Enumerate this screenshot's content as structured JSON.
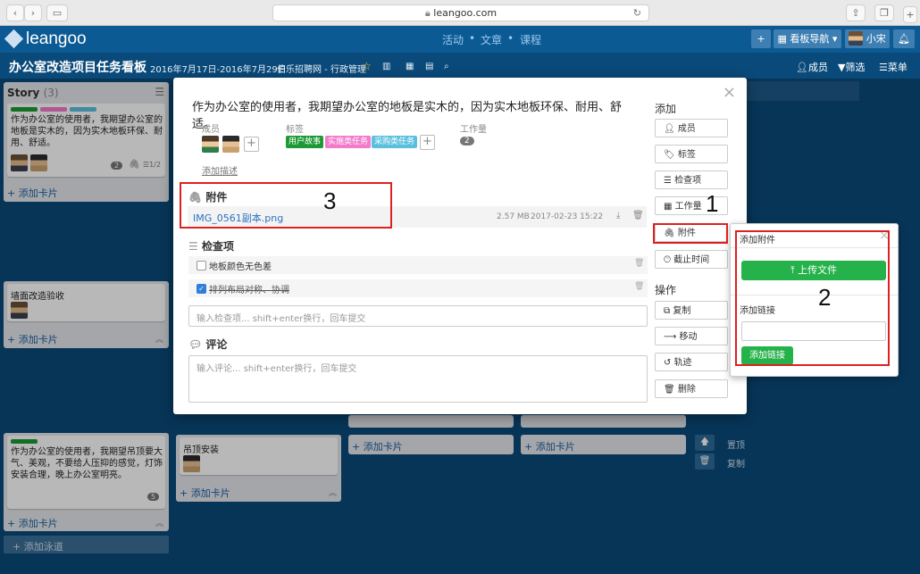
{
  "browser": {
    "url": "leangoo.com",
    "back": "‹",
    "forward": "›",
    "share": "⇪",
    "tabs": "❐",
    "newtab": "+"
  },
  "app": {
    "logo": "leangoo",
    "nav": [
      "活动",
      "文章",
      "课程"
    ],
    "nav_sep": "•",
    "plus": "+",
    "board_nav": "看板导航",
    "user": "小宋"
  },
  "board": {
    "title": "办公室改造项目任务看板",
    "dates": "2016年7月17日-2016年7月29日",
    "org": "伯乐招聘网 - 行政管理",
    "members": "成员",
    "filter": "筛选",
    "menu": "菜单"
  },
  "lists": {
    "story": {
      "title": "Story",
      "count": "(3)",
      "card1_text": "作为办公室的使用者，我期望办公室的地板是实木的，因为实木地板环保、耐用、舒适。",
      "card1_badge": "2",
      "card1_checks": "1/2",
      "add": "+ 添加卡片"
    },
    "list2": {
      "card_text": "墙面改造验收",
      "add": "+ 添加卡片"
    },
    "list3": {
      "card_text": "作为办公室的使用者，我期望吊顶要大气、美观，不要给人压抑的感觉，灯饰安装合理，晚上办公室明亮。",
      "card_badge": "5",
      "add": "+ 添加卡片"
    },
    "list4": {
      "card_text": "吊顶安装",
      "add": "+ 添加卡片"
    },
    "list5_add": "+ 添加卡片",
    "list6_add": "+ 添加卡片",
    "add_lane": "+ 添加泳道",
    "top": "置顶",
    "copy": "复制"
  },
  "modal": {
    "title": "作为办公室的使用者，我期望办公室的地板是实木的，因为实木地板环保、耐用、舒适。",
    "close": "×",
    "members_label": "成员",
    "labels_label": "标签",
    "workload_label": "工作量",
    "workload_value": "2",
    "tags": [
      {
        "text": "用户故事",
        "color": "#1d9a35"
      },
      {
        "text": "实施类任务",
        "color": "#f27bcb"
      },
      {
        "text": "采购类任务",
        "color": "#5bc0de"
      }
    ],
    "add_desc": "添加描述",
    "attachments": {
      "title": "附件",
      "file_name": "IMG_0561副本.png",
      "file_size": "2.57 MB",
      "file_date": "2017-02-23 15:22"
    },
    "checklist": {
      "title": "检查项",
      "items": [
        {
          "text": "地板颜色无色差",
          "checked": false
        },
        {
          "text": "排列布局对称、协调",
          "checked": true
        }
      ],
      "input_placeholder": "输入检查项... shift+enter换行，回车提交"
    },
    "comments": {
      "title": "评论",
      "placeholder": "输入评论... shift+enter换行，回车提交"
    },
    "sidebar": {
      "add_title": "添加",
      "add_buttons": [
        "成员",
        "标签",
        "检查项",
        "工作量",
        "附件",
        "截止时间"
      ],
      "ops_title": "操作",
      "ops_buttons": [
        "复制",
        "移动",
        "轨迹",
        "删除"
      ]
    }
  },
  "popover": {
    "title": "添加附件",
    "close": "×",
    "upload_button": "上传文件",
    "link_label": "添加链接",
    "link_button": "添加链接"
  },
  "annotations": [
    "1",
    "2",
    "3"
  ]
}
